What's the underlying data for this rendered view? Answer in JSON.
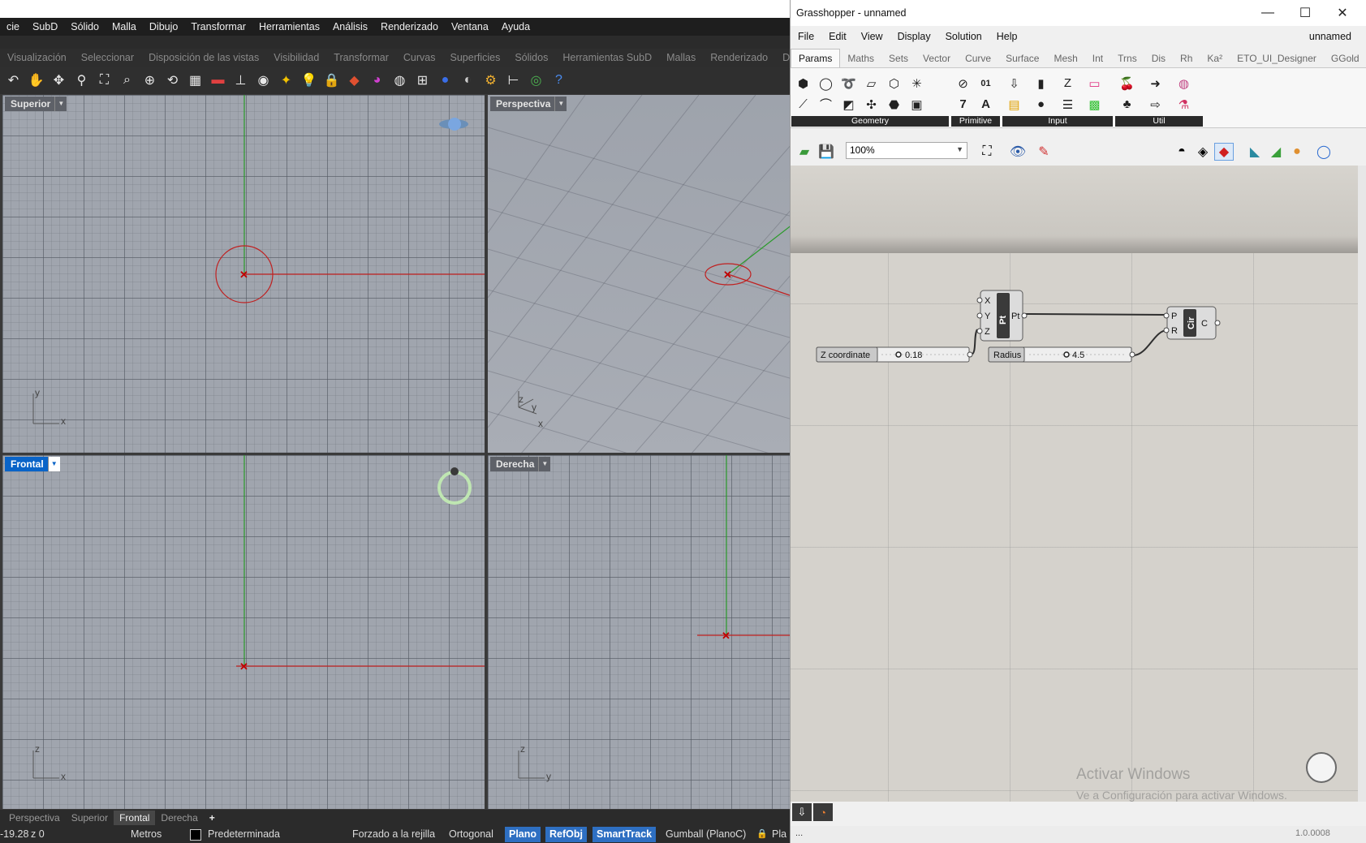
{
  "rhino": {
    "menu": [
      "cie",
      "SubD",
      "Sólido",
      "Malla",
      "Dibujo",
      "Transformar",
      "Herramientas",
      "Análisis",
      "Renderizado",
      "Ventana",
      "Ayuda"
    ],
    "toolbar_tabs": [
      "Visualización",
      "Seleccionar",
      "Disposición de las vistas",
      "Visibilidad",
      "Transformar",
      "Curvas",
      "Superficies",
      "Sólidos",
      "Herramientas SubD",
      "Mallas",
      "Renderizado",
      "Dibujo"
    ],
    "viewports": {
      "top": {
        "label": "Superior",
        "axis_a": "y",
        "axis_b": "x"
      },
      "perspective": {
        "label": "Perspectiva",
        "axis_a": "z",
        "axis_b": "y",
        "axis_c": "x"
      },
      "front": {
        "label": "Frontal",
        "axis_a": "z",
        "axis_b": "x"
      },
      "right": {
        "label": "Derecha",
        "axis_a": "z",
        "axis_b": "y"
      }
    },
    "viewport_tabs": [
      "Perspectiva",
      "Superior",
      "Frontal",
      "Derecha",
      "+"
    ],
    "status": {
      "coords": "-19.28",
      "z": "z 0",
      "units": "Metros",
      "layer": "Predeterminada",
      "grid_snap": "Forzado a la rejilla",
      "ortho": "Ortogonal",
      "planar": "Plano",
      "osnap": "RefObj",
      "smarttrack": "SmartTrack",
      "gumball": "Gumball (PlanoC)",
      "extra": "Pla"
    }
  },
  "gh": {
    "title": "Grasshopper - unnamed",
    "menu": [
      "File",
      "Edit",
      "View",
      "Display",
      "Solution",
      "Help"
    ],
    "doc_name": "unnamed",
    "tabs": [
      "Params",
      "Maths",
      "Sets",
      "Vector",
      "Curve",
      "Surface",
      "Mesh",
      "Int",
      "Trns",
      "Dis",
      "Rh",
      "Ka²",
      "ETO_UI_Designer",
      "GGold"
    ],
    "groups": [
      "Geometry",
      "Primitive",
      "Input",
      "Util"
    ],
    "zoom": "100%",
    "components": {
      "point": {
        "inputs": [
          "X",
          "Y",
          "Z"
        ],
        "name": "Pt",
        "output": "Pt"
      },
      "circle": {
        "inputs": [
          "P",
          "R"
        ],
        "name": "Cir",
        "output": "C"
      }
    },
    "sliders": {
      "z": {
        "label": "Z coordinate",
        "value": "0.18"
      },
      "radius": {
        "label": "Radius",
        "value": "4.5"
      }
    },
    "watermark": {
      "line1": "Activar Windows",
      "line2": "Ve a Configuración para activar Windows."
    },
    "status_left": "...",
    "version": "1.0.0008"
  }
}
